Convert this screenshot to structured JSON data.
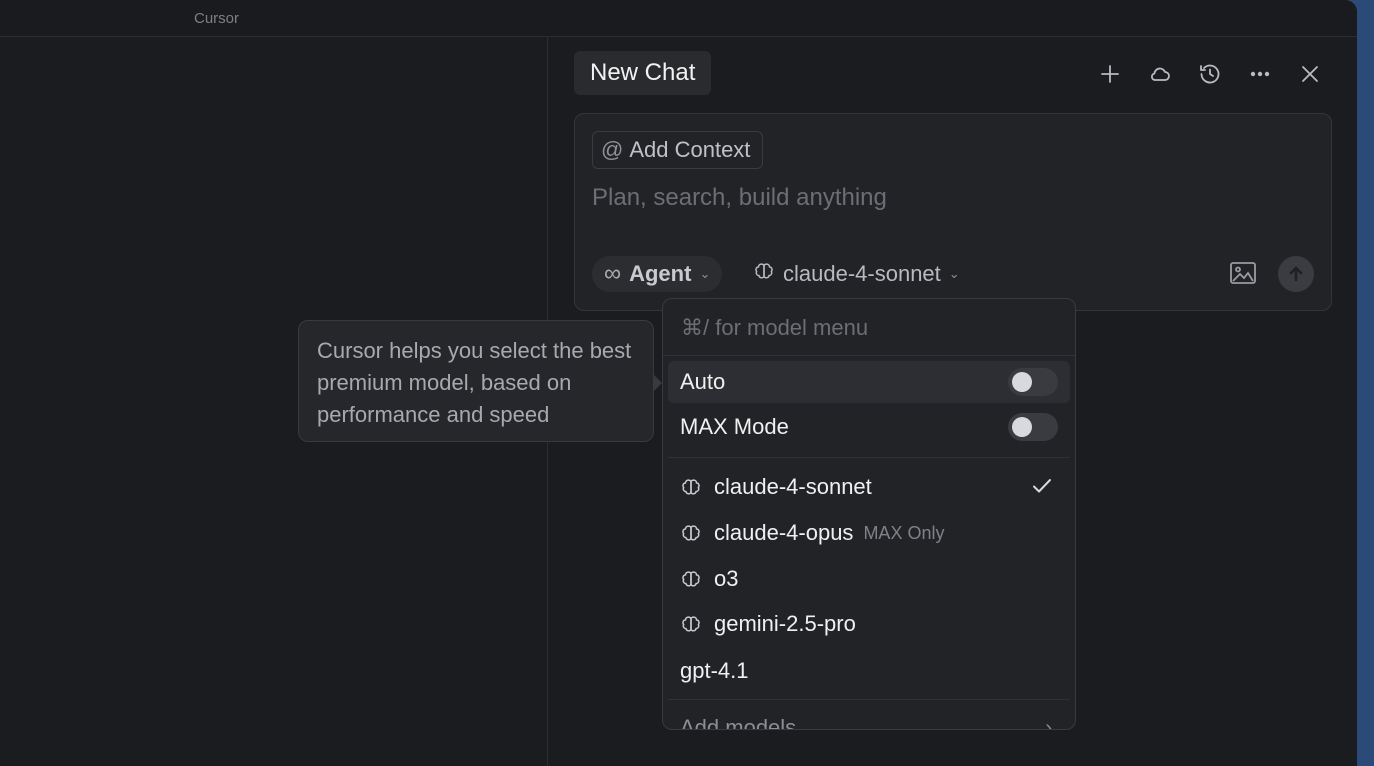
{
  "window": {
    "title": "Cursor"
  },
  "chat": {
    "tab_title": "New Chat",
    "header_icons": [
      "plus-icon",
      "cloud-icon",
      "history-icon",
      "more-icon",
      "close-icon"
    ]
  },
  "composer": {
    "add_context_label": "Add Context",
    "at_symbol": "@",
    "placeholder": "Plan, search, build anything",
    "mode_label": "Agent",
    "mode_icon": "∞",
    "model_label": "claude-4-sonnet"
  },
  "tooltip": {
    "text": "Cursor helps you select the best premium model, based on performance and speed"
  },
  "model_menu": {
    "search_placeholder": "⌘/ for model menu",
    "auto_label": "Auto",
    "auto_enabled": false,
    "max_mode_label": "MAX Mode",
    "max_mode_enabled": false,
    "models": [
      {
        "name": "claude-4-sonnet",
        "icon": "brain-icon",
        "selected": true,
        "badge": ""
      },
      {
        "name": "claude-4-opus",
        "icon": "brain-icon",
        "selected": false,
        "badge": "MAX Only"
      },
      {
        "name": "o3",
        "icon": "brain-icon",
        "selected": false,
        "badge": ""
      },
      {
        "name": "gemini-2.5-pro",
        "icon": "brain-icon",
        "selected": false,
        "badge": ""
      },
      {
        "name": "gpt-4.1",
        "icon": "",
        "selected": false,
        "badge": ""
      }
    ],
    "add_models_label": "Add models"
  }
}
